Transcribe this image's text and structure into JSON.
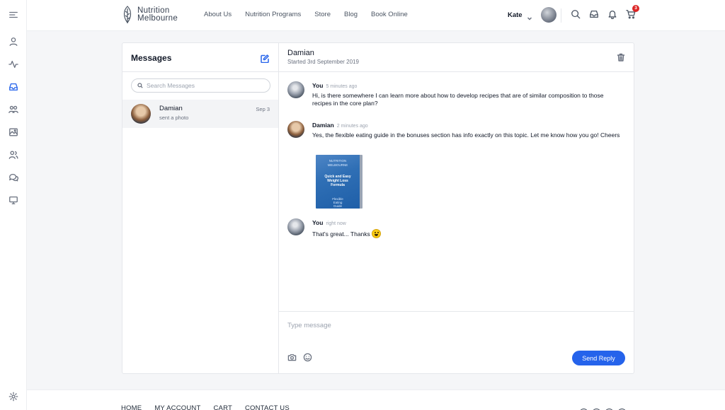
{
  "header": {
    "logo_line1": "Nutrition",
    "logo_line2": "Melbourne",
    "nav": [
      "About Us",
      "Nutrition Programs",
      "Store",
      "Blog",
      "Book Online"
    ],
    "user_name": "Kate",
    "cart_count": "3"
  },
  "messages_list": {
    "title": "Messages",
    "search_placeholder": "Search Messages",
    "threads": [
      {
        "name": "Damian",
        "preview": "sent a photo",
        "date": "Sep 3"
      }
    ]
  },
  "conversation": {
    "name": "Damian",
    "started": "Started 3rd September 2019",
    "messages": [
      {
        "sender": "You",
        "time": "5 minutes ago",
        "text": "Hi, is there somewhere I can learn more about how to develop recipes that are of similar composition to those recipes in the core plan?"
      },
      {
        "sender": "Damian",
        "time": "2 minutes ago",
        "text": "Yes, the flexible eating guide in the bonuses section has info exactly on this topic. Let me know how you go! Cheers"
      },
      {
        "sender": "You",
        "time": "right now",
        "text": "That's great... Thanks"
      }
    ],
    "photo_text": {
      "brand1": "NUTRITION",
      "brand2": "MELBOURNE",
      "title": "Quick and Easy Weight Loss Formula",
      "sub": "Flexible Eating Guide"
    }
  },
  "reply": {
    "placeholder": "Type message",
    "send_label": "Send Reply"
  },
  "footer": {
    "links": [
      "HOME",
      "MY ACCOUNT",
      "CART",
      "CONTACT US"
    ]
  },
  "colors": {
    "accent": "#2563eb",
    "badge": "#dc2626"
  }
}
